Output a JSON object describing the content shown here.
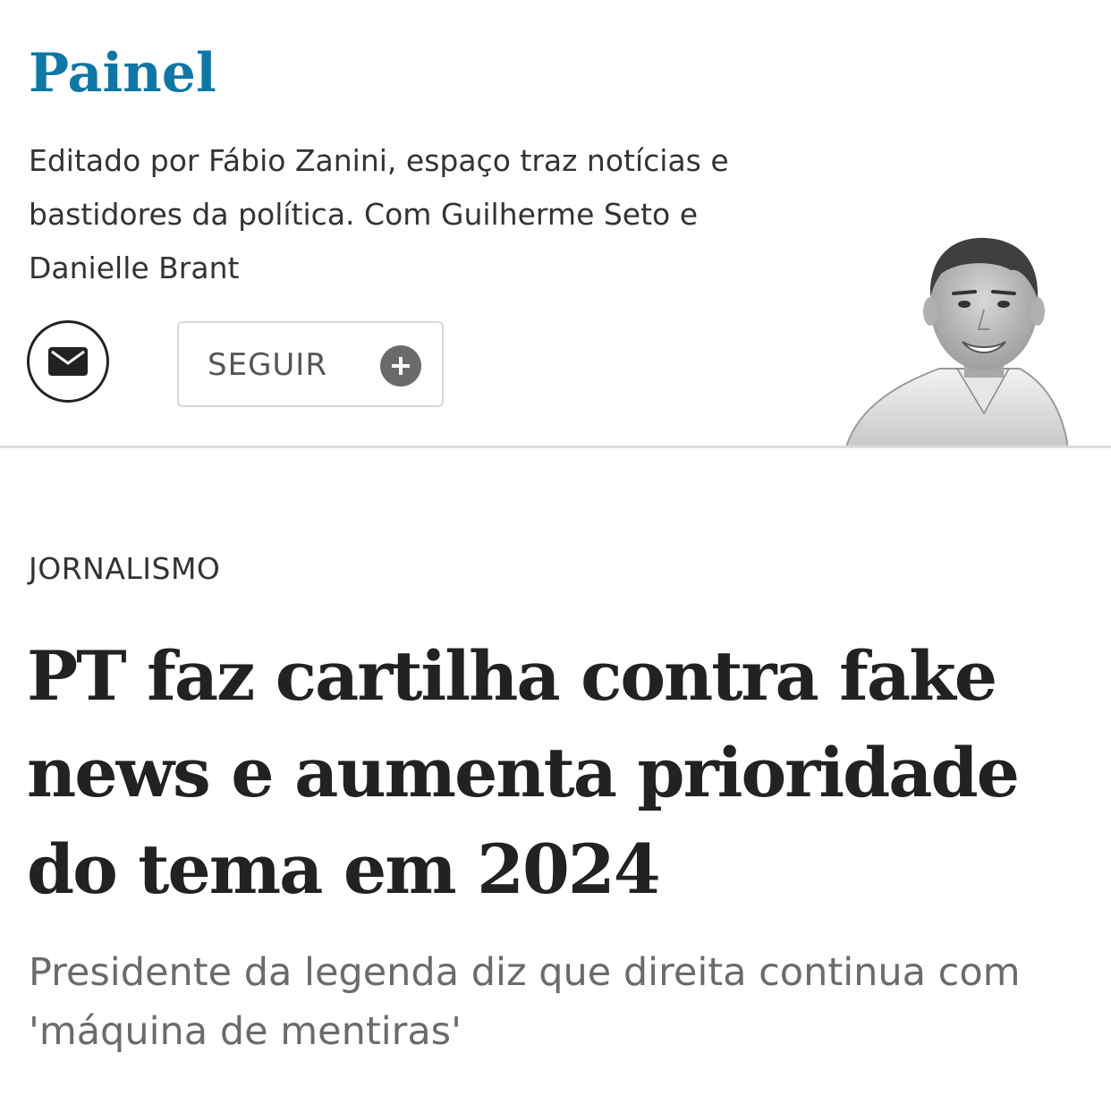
{
  "column": {
    "title": "Painel",
    "description": "Editado por Fábio Zanini, espaço traz notícias e bastidores da política. Com Guilherme Seto e Danielle Brant",
    "mail_icon": "envelope-icon",
    "follow_label": "SEGUIR",
    "follow_icon": "plus-circle-icon"
  },
  "article": {
    "section": "JORNALISMO",
    "headline": "PT faz cartilha contra fake news e aumenta prioridade do tema em 2024",
    "subheadline": "Presidente da legenda diz que direita continua com 'máquina de mentiras'"
  },
  "colors": {
    "brand": "#0e77a6",
    "text_dark": "#222222",
    "divider": "#dcdcdc",
    "plus_icon_bg": "#6a6a6a"
  }
}
